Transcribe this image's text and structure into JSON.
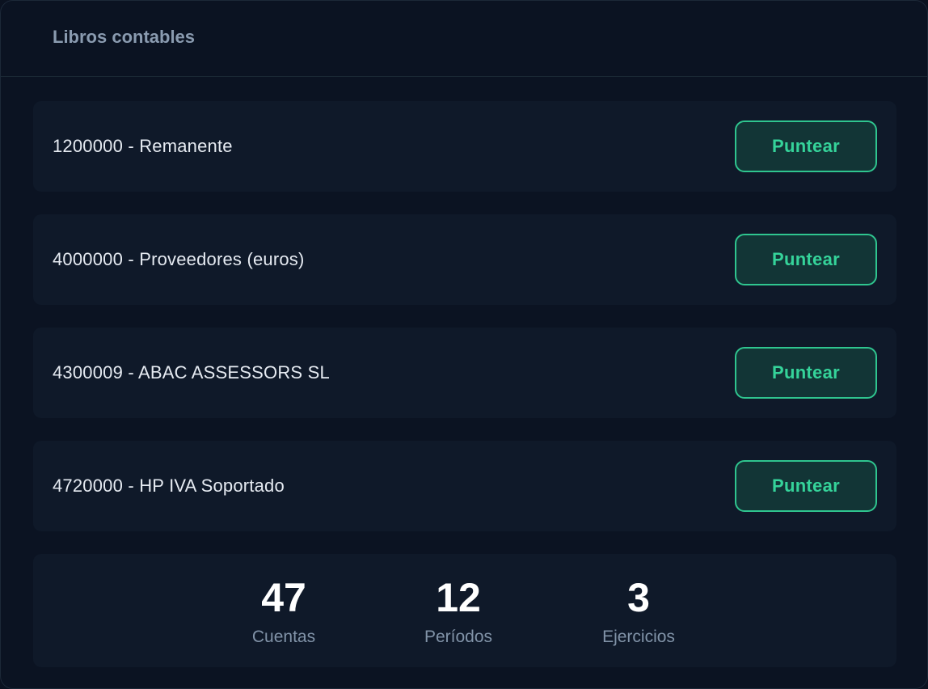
{
  "panel": {
    "title": "Libros contables"
  },
  "accounts": [
    {
      "label": "1200000 - Remanente",
      "action": "Puntear"
    },
    {
      "label": "4000000 - Proveedores (euros)",
      "action": "Puntear"
    },
    {
      "label": "4300009 - ABAC ASSESSORS SL",
      "action": "Puntear"
    },
    {
      "label": "4720000 - HP IVA Soportado",
      "action": "Puntear"
    }
  ],
  "stats": [
    {
      "value": "47",
      "label": "Cuentas"
    },
    {
      "value": "12",
      "label": "Períodos"
    },
    {
      "value": "3",
      "label": "Ejercicios"
    }
  ],
  "colors": {
    "background": "#0b1322",
    "row_background": "#0f1929",
    "accent": "#35d39a",
    "button_fill": "#123536"
  }
}
